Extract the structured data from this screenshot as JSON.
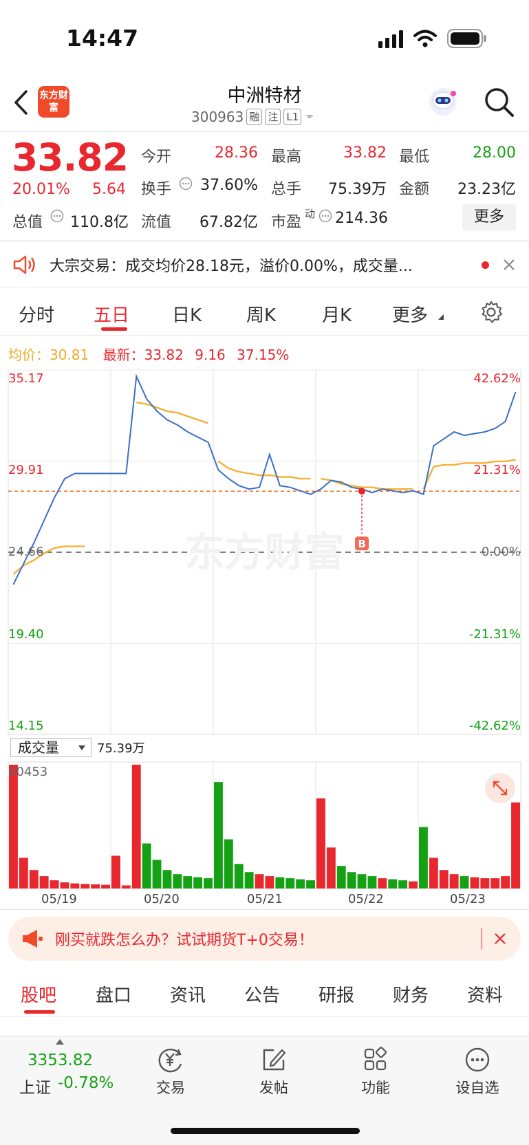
{
  "status": {
    "time": "14:47"
  },
  "header": {
    "logo_text": "东方财富",
    "title": "中洲特材",
    "code": "300963",
    "tags": [
      "融",
      "注",
      "L1"
    ]
  },
  "quote": {
    "price": "33.82",
    "change_pct": "20.01%",
    "change": "5.64",
    "open_label": "今开",
    "open": "28.36",
    "high_label": "最高",
    "high": "33.82",
    "low_label": "最低",
    "low": "28.00",
    "turnover_label": "换手",
    "turnover": "37.60%",
    "volume_label": "总手",
    "volume": "75.39万",
    "amount_label": "金额",
    "amount": "23.23亿",
    "mktcap_label": "总值",
    "mktcap": "110.8亿",
    "float_label": "流值",
    "float": "67.82亿",
    "pe_label": "市盈",
    "pe_sup": "动",
    "pe": "214.36",
    "more_label": "更多"
  },
  "notice": {
    "text": "大宗交易：成交均价28.18元，溢价0.00%，成交量..."
  },
  "tabs": [
    {
      "label": "分时"
    },
    {
      "label": "五日"
    },
    {
      "label": "日K"
    },
    {
      "label": "周K"
    },
    {
      "label": "月K"
    },
    {
      "label": "更多"
    }
  ],
  "chart_info": {
    "avg_label": "均价：",
    "avg_value": "30.81",
    "latest_label": "最新：",
    "latest_value": "33.82",
    "latest_change": "9.16",
    "latest_pct": "37.15%",
    "watermark": "东方财富",
    "marker": "B"
  },
  "chart_data": {
    "type": "line",
    "x_days": [
      "05/19",
      "05/20",
      "05/21",
      "05/22",
      "05/23"
    ],
    "y_ticks_left": [
      "35.17",
      "29.91",
      "24.66",
      "19.40",
      "14.15"
    ],
    "y_ticks_right": [
      "42.62%",
      "21.31%",
      "0.00%",
      "-21.31%",
      "-42.62%"
    ],
    "ylim": [
      14.15,
      35.17
    ],
    "reference_price": 24.66,
    "latest_price": 28.18,
    "series": [
      {
        "name": "价格",
        "color": "#3a6fc4",
        "values": [
          22.8,
          24.0,
          25.2,
          26.5,
          27.8,
          28.9,
          29.2,
          29.2,
          29.2,
          29.2,
          29.2,
          29.2,
          34.8,
          33.5,
          32.8,
          32.3,
          32.0,
          31.6,
          31.3,
          31.0,
          29.4,
          28.9,
          28.5,
          28.3,
          28.4,
          30.3,
          28.5,
          28.4,
          28.2,
          28.0,
          28.3,
          28.8,
          28.7,
          28.4,
          28.3,
          28.1,
          28.3,
          28.2,
          28.1,
          28.2,
          28.0,
          30.8,
          31.2,
          31.6,
          31.4,
          31.5,
          31.6,
          31.8,
          32.2,
          33.9
        ]
      },
      {
        "name": "均价",
        "color": "#f4b234",
        "values": [
          23.4,
          23.9,
          24.2,
          24.6,
          24.9,
          25.0,
          25.0,
          25.0,
          null,
          null,
          null,
          null,
          33.3,
          33.2,
          33.0,
          32.8,
          32.7,
          32.5,
          32.3,
          32.1,
          29.9,
          29.5,
          29.3,
          29.2,
          29.1,
          29.1,
          29.0,
          29.0,
          28.9,
          28.9,
          28.9,
          28.8,
          28.6,
          28.5,
          28.4,
          28.4,
          28.3,
          28.3,
          28.3,
          28.3,
          28.3,
          29.6,
          29.7,
          29.7,
          29.8,
          29.8,
          29.8,
          29.9,
          29.9,
          30.0
        ]
      }
    ],
    "volume_max": 60453,
    "volume_total": "75.39万",
    "volume": [
      60453,
      15000,
      9000,
      6000,
      4000,
      3000,
      2500,
      2200,
      2000,
      1800,
      16000,
      1500,
      60453,
      22000,
      14000,
      9000,
      7000,
      6000,
      5500,
      5000,
      52000,
      24000,
      12000,
      8000,
      7000,
      6000,
      5500,
      5000,
      4500,
      4000,
      44000,
      20000,
      11000,
      8000,
      7000,
      6000,
      5000,
      4500,
      4000,
      3500,
      30000,
      15000,
      9000,
      7000,
      6000,
      5500,
      5000,
      5000,
      6000,
      42000
    ]
  },
  "volume_panel": {
    "label": "成交量",
    "value": "75.39万",
    "max": "60453"
  },
  "banner": {
    "text": "刚买就跌怎么办？试试期货T+0交易！"
  },
  "bottom_tabs": [
    {
      "label": "股吧"
    },
    {
      "label": "盘口"
    },
    {
      "label": "资讯"
    },
    {
      "label": "公告"
    },
    {
      "label": "研报"
    },
    {
      "label": "财务"
    },
    {
      "label": "资料"
    }
  ],
  "bottom_bar": {
    "index_value": "3353.82",
    "index_name": "上证",
    "index_change": "-0.78%",
    "items": [
      {
        "label": "交易"
      },
      {
        "label": "发帖"
      },
      {
        "label": "功能"
      },
      {
        "label": "设自选"
      }
    ]
  },
  "colors": {
    "up": "#e8272f",
    "down": "#14a214",
    "price_line": "#3a6fc4",
    "avg_line": "#f4b234",
    "accent": "#ef4b2b"
  }
}
